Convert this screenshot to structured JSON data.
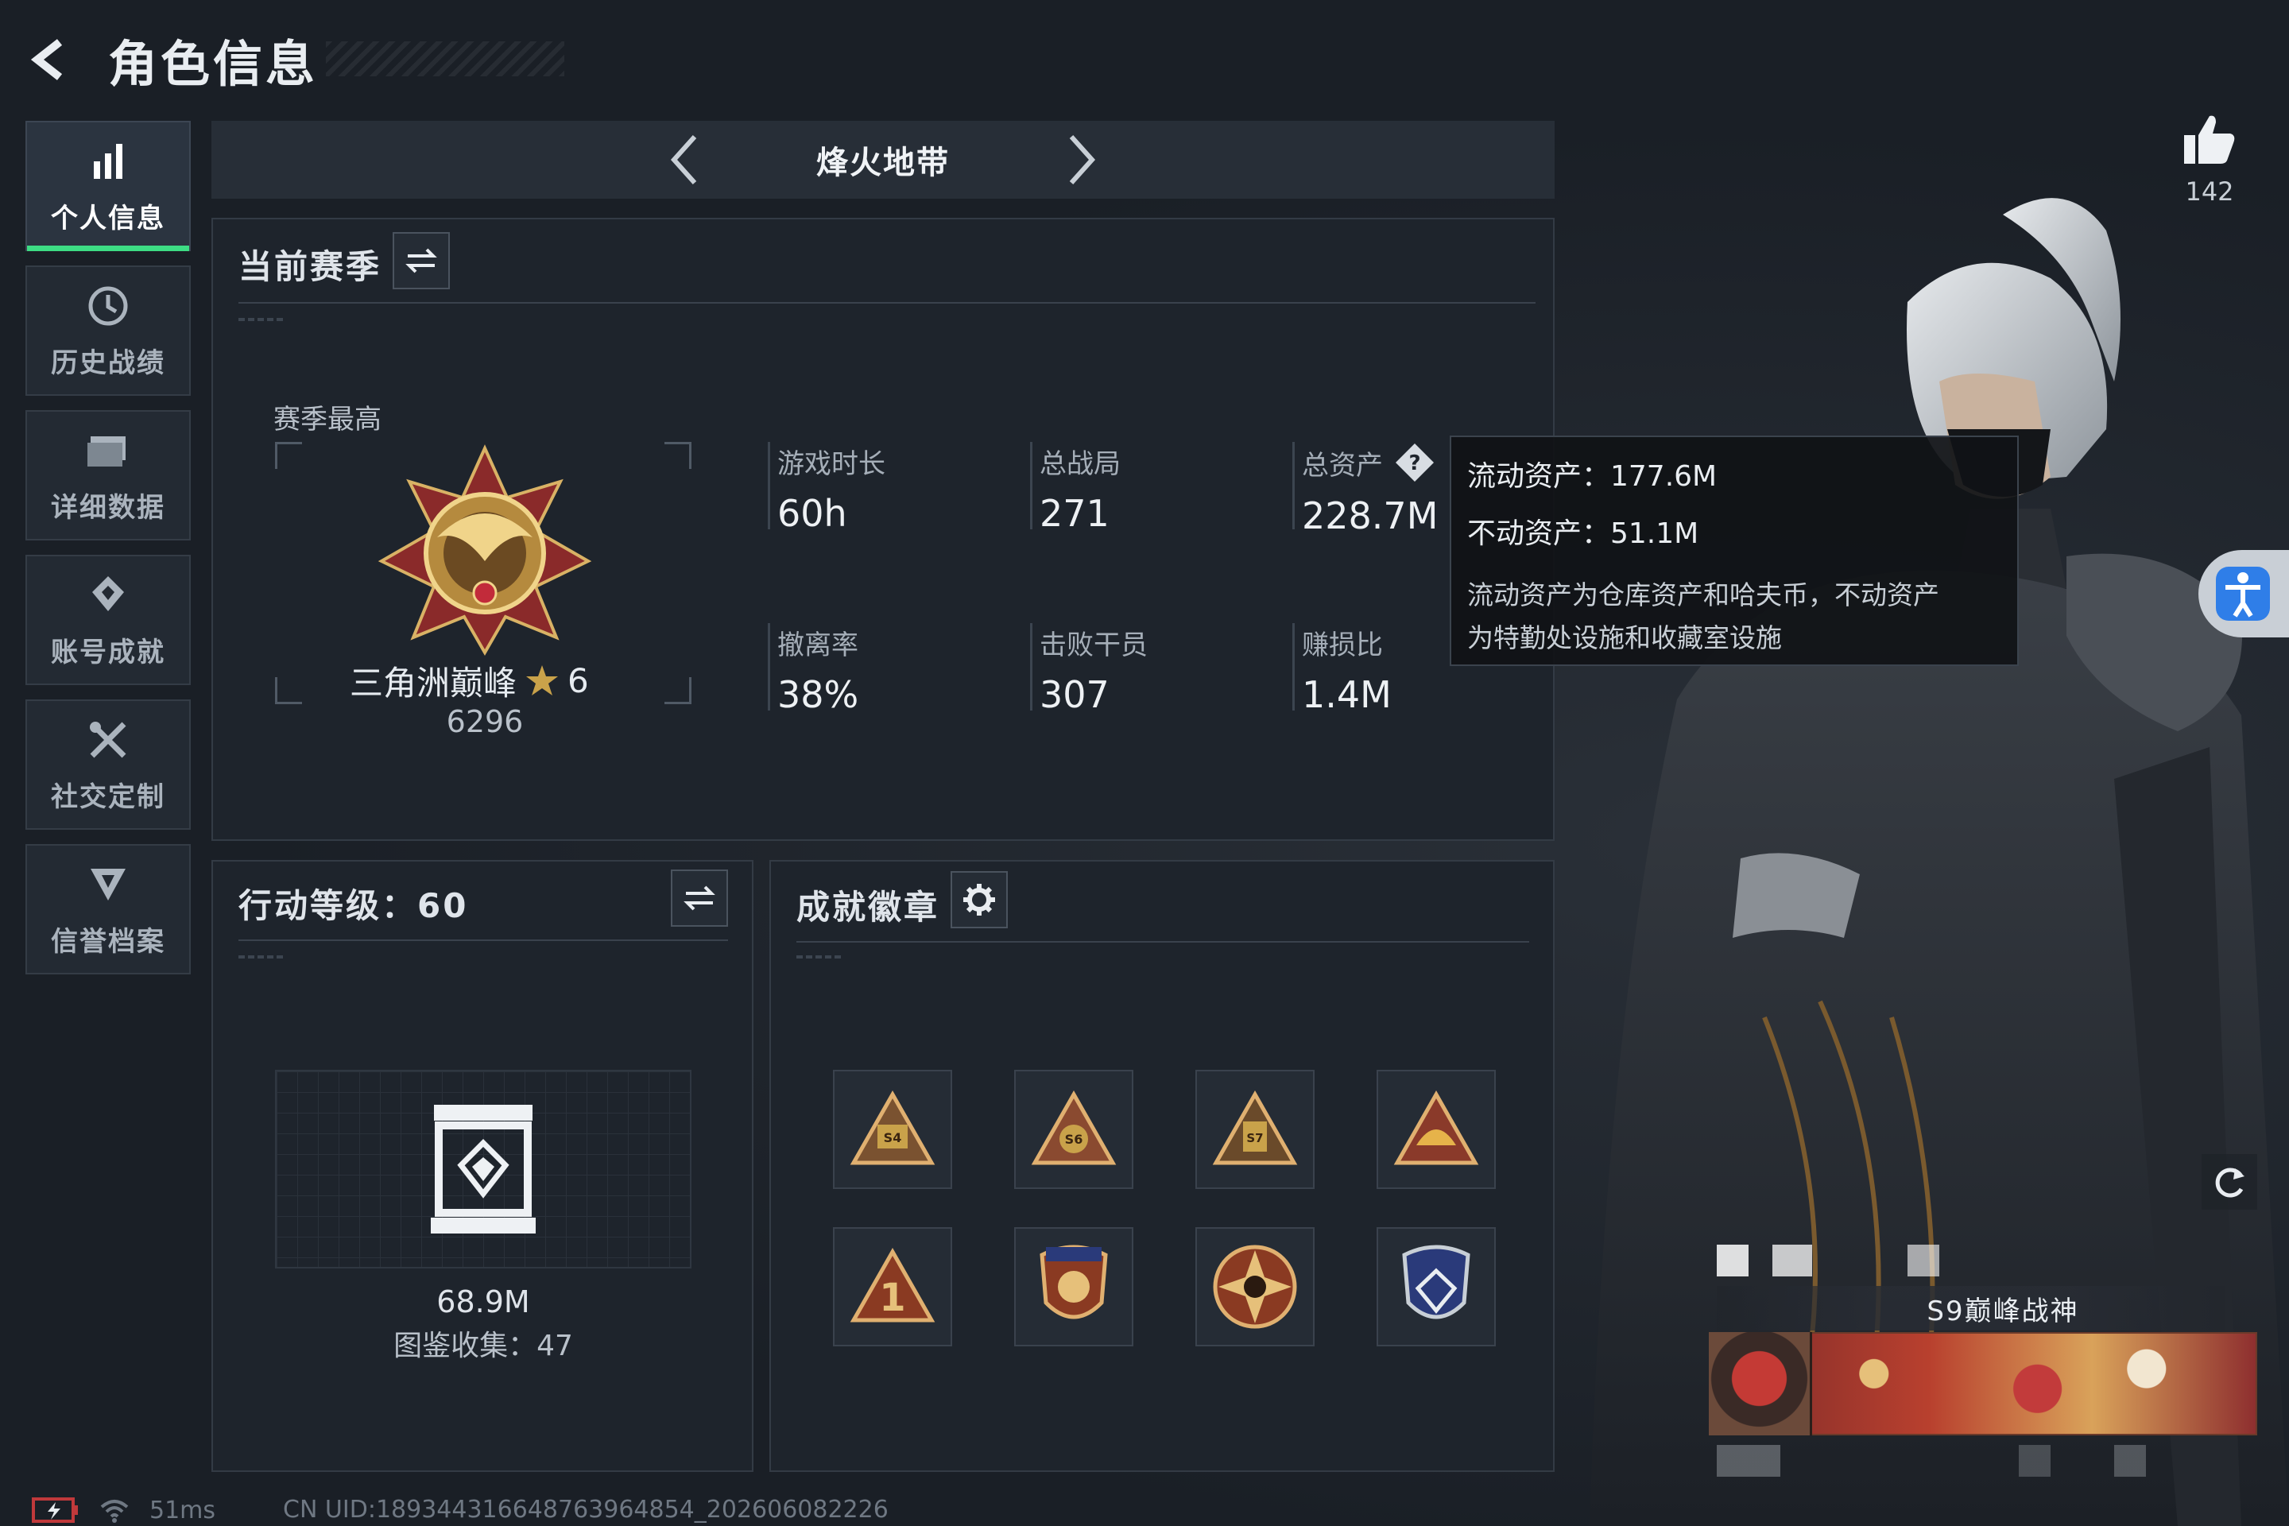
{
  "header": {
    "title": "角色信息"
  },
  "sidebar": {
    "items": [
      {
        "label": "个人信息",
        "icon": "bar-chart-icon",
        "active": true
      },
      {
        "label": "历史战绩",
        "icon": "history-clock-icon",
        "active": false
      },
      {
        "label": "详细数据",
        "icon": "folder-icon",
        "active": false
      },
      {
        "label": "账号成就",
        "icon": "achievement-icon",
        "active": false
      },
      {
        "label": "社交定制",
        "icon": "tools-icon",
        "active": false
      },
      {
        "label": "信誉档案",
        "icon": "credit-shield-icon",
        "active": false
      }
    ]
  },
  "mode": {
    "name": "烽火地带"
  },
  "season": {
    "title": "当前赛季",
    "best_label": "赛季最高",
    "rank_name": "三角洲巅峰",
    "rank_stars": "6",
    "rank_score": "6296",
    "stats": [
      {
        "label": "游戏时长",
        "value": "60h"
      },
      {
        "label": "总战局",
        "value": "271"
      },
      {
        "label": "总资产",
        "value": "228.7M"
      },
      {
        "label": "撤离率",
        "value": "38%"
      },
      {
        "label": "击败干员",
        "value": "307"
      },
      {
        "label": "赚损比",
        "value": "1.4M"
      }
    ]
  },
  "tooltip": {
    "liquid": "流动资产：177.6M",
    "fixed": "不动资产：51.1M",
    "desc_line1": "流动资产为仓库资产和哈夫币，不动资产",
    "desc_line2": "为特勤处设施和收藏室设施"
  },
  "action_level": {
    "title": "行动等级：60",
    "codex_value": "68.9M",
    "codex_count": "图鉴收集：47"
  },
  "achievements": {
    "title": "成就徽章",
    "badges": [
      "S4 badge",
      "S6 badge",
      "S7 badge",
      "crest badge",
      "rank 1 badge",
      "star shield badge",
      "compass star badge",
      "blue shield badge"
    ]
  },
  "likes": {
    "count": "142"
  },
  "card": {
    "title": "S9巅峰战神"
  },
  "status": {
    "ping": "51ms",
    "uid": "CN UID:1893443166487639648​54_202606082226"
  },
  "colors": {
    "accent_green": "#3ddc84",
    "background": "#1a1f26",
    "gold": "#c9a24a"
  }
}
